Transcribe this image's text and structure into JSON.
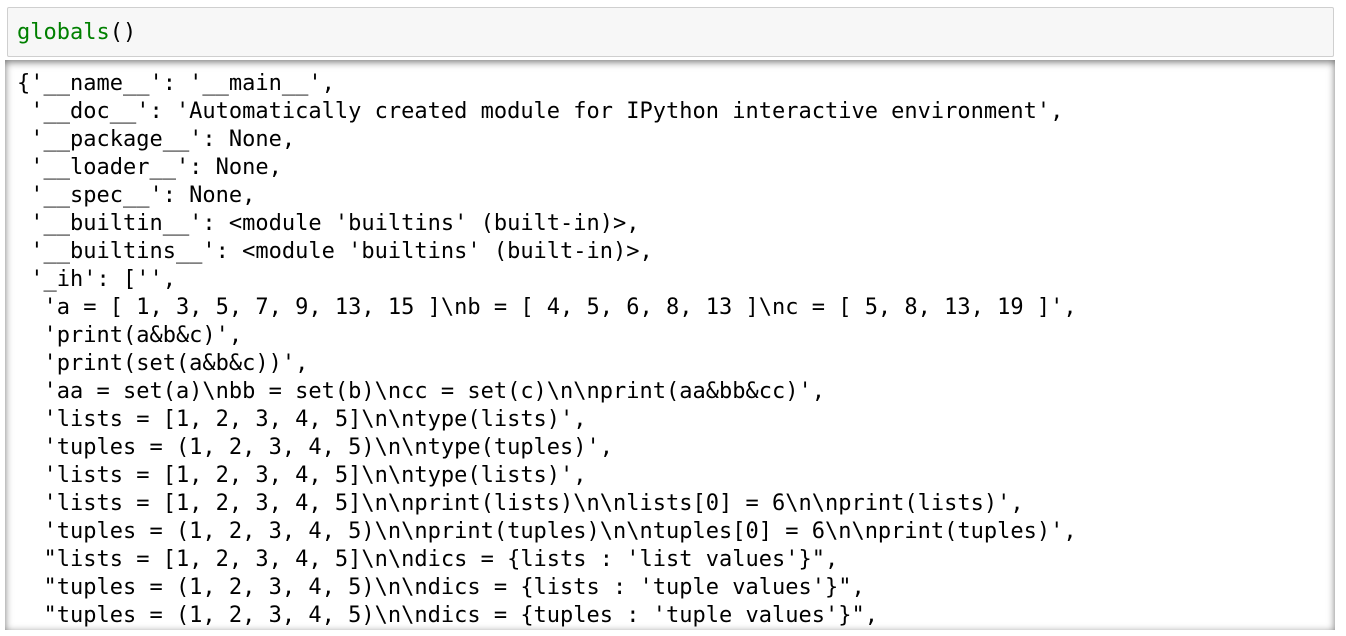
{
  "input_cell": {
    "func_name": "globals",
    "parens": "()"
  },
  "output": {
    "lines": [
      "{'__name__': '__main__',",
      " '__doc__': 'Automatically created module for IPython interactive environment',",
      " '__package__': None,",
      " '__loader__': None,",
      " '__spec__': None,",
      " '__builtin__': <module 'builtins' (built-in)>,",
      " '__builtins__': <module 'builtins' (built-in)>,",
      " '_ih': ['',",
      "  'a = [ 1, 3, 5, 7, 9, 13, 15 ]\\nb = [ 4, 5, 6, 8, 13 ]\\nc = [ 5, 8, 13, 19 ]',",
      "  'print(a&b&c)',",
      "  'print(set(a&b&c))',",
      "  'aa = set(a)\\nbb = set(b)\\ncc = set(c)\\n\\nprint(aa&bb&cc)',",
      "  'lists = [1, 2, 3, 4, 5]\\n\\ntype(lists)',",
      "  'tuples = (1, 2, 3, 4, 5)\\n\\ntype(tuples)',",
      "  'lists = [1, 2, 3, 4, 5]\\n\\ntype(lists)',",
      "  'lists = [1, 2, 3, 4, 5]\\n\\nprint(lists)\\n\\nlists[0] = 6\\n\\nprint(lists)',",
      "  'tuples = (1, 2, 3, 4, 5)\\n\\nprint(tuples)\\n\\ntuples[0] = 6\\n\\nprint(tuples)',",
      "  \"lists = [1, 2, 3, 4, 5]\\n\\ndics = {lists : 'list values'}\",",
      "  \"tuples = (1, 2, 3, 4, 5)\\n\\ndics = {lists : 'tuple values'}\",",
      "  \"tuples = (1, 2, 3, 4, 5)\\n\\ndics = {tuples : 'tuple values'}\","
    ]
  }
}
